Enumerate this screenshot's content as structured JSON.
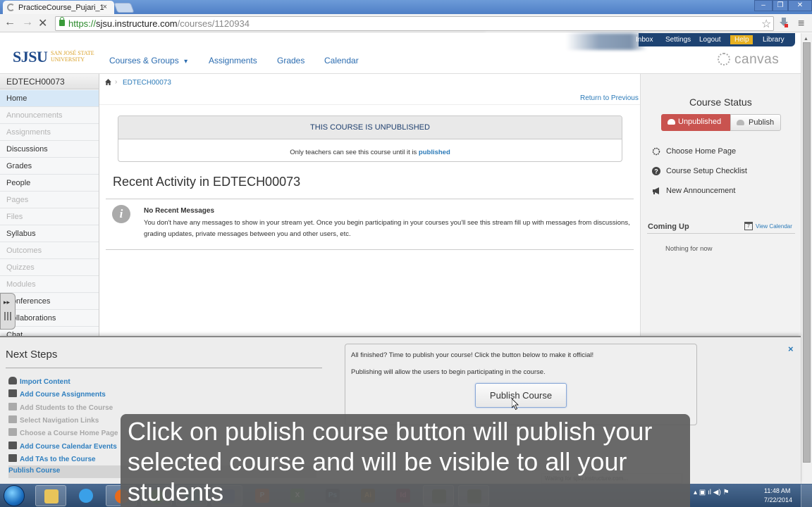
{
  "browser": {
    "tab_title": "PracticeCourse_Pujari_1",
    "tab_close": "×",
    "url_scheme": "https://",
    "url_host": "sjsu.instructure.com",
    "url_path": "/courses/1120934",
    "window_controls": [
      "–",
      "❐",
      "✕"
    ],
    "nav": {
      "back": "←",
      "forward": "→",
      "stop": "✕"
    },
    "star": "☆",
    "menu": "≡",
    "status": "Waiting for sjsu.instructure.com..."
  },
  "header": {
    "logo_main": "SJSU",
    "logo_sub": "SAN JOSÉ STATE UNIVERSITY",
    "nav": [
      "Courses & Groups",
      "Assignments",
      "Grades",
      "Calendar"
    ],
    "dropdown_caret": "▾",
    "user_nav": [
      "Inbox",
      "Settings",
      "Logout",
      "Help",
      "Library"
    ],
    "canvas_brand": "canvas"
  },
  "course": {
    "code": "EDTECH00073",
    "nav": [
      {
        "label": "Home",
        "state": "active"
      },
      {
        "label": "Announcements",
        "state": "off"
      },
      {
        "label": "Assignments",
        "state": "off"
      },
      {
        "label": "Discussions",
        "state": "on"
      },
      {
        "label": "Grades",
        "state": "on"
      },
      {
        "label": "People",
        "state": "on"
      },
      {
        "label": "Pages",
        "state": "off"
      },
      {
        "label": "Files",
        "state": "off"
      },
      {
        "label": "Syllabus",
        "state": "on"
      },
      {
        "label": "Outcomes",
        "state": "off"
      },
      {
        "label": "Quizzes",
        "state": "off"
      },
      {
        "label": "Modules",
        "state": "off"
      },
      {
        "label": "Conferences",
        "state": "on"
      },
      {
        "label": "Collaborations",
        "state": "on"
      },
      {
        "label": "Chat",
        "state": "on"
      }
    ]
  },
  "main": {
    "breadcrumb_sep": "›",
    "breadcrumb": "EDTECH00073",
    "return_previous": "Return to Previous",
    "unpublished_banner": "THIS COURSE IS UNPUBLISHED",
    "unpublished_note": "Only teachers can see this course until it is ",
    "unpublished_link": "published",
    "recent_title": "Recent Activity in EDTECH00073",
    "info_glyph": "i",
    "no_recent_title": "No Recent Messages",
    "no_recent_text": "You don't have any messages to show in your stream yet. Once you begin participating in your courses you'll see this stream fill up with messages from discussions, grading updates, private messages between you and other users, etc."
  },
  "sidebar": {
    "course_status_title": "Course Status",
    "unpublished_label": "Unpublished",
    "publish_label": "Publish",
    "links": [
      "Choose Home Page",
      "Course Setup Checklist",
      "New Announcement"
    ],
    "coming_up_title": "Coming Up",
    "view_calendar": "View Calendar",
    "nothing_now": "Nothing for now",
    "status_color": "#c9534f"
  },
  "next_steps": {
    "title": "Next Steps",
    "steps": [
      {
        "label": "Import Content",
        "state": "on",
        "icon": "cloud-icon"
      },
      {
        "label": "Add Course Assignments",
        "state": "on",
        "icon": "document-icon"
      },
      {
        "label": "Add Students to the Course",
        "state": "off",
        "icon": "users-icon"
      },
      {
        "label": "Select Navigation Links",
        "state": "off",
        "icon": "link-icon"
      },
      {
        "label": "Choose a Course Home Page",
        "state": "off",
        "icon": "home-page-icon"
      },
      {
        "label": "Add Course Calendar Events",
        "state": "on",
        "icon": "calendar-icon"
      },
      {
        "label": "Add TAs to the Course",
        "state": "on",
        "icon": "user-add-icon"
      },
      {
        "label": "Publish Course",
        "state": "on",
        "icon": ""
      }
    ],
    "publish_text1": "All finished? Time to publish your course! Click the button below to make it official!",
    "publish_text2": "Publishing will allow the users to begin participating in the course.",
    "publish_button": "Publish Course",
    "close": "×"
  },
  "caption": "Click on publish course  button will publish your selected course and will be visible to all your students",
  "taskbar": {
    "apps": [
      "explorer",
      "internet-explorer",
      "firefox",
      "chrome",
      "other",
      "word",
      "powerpoint",
      "excel",
      "photoshop",
      "illustrator",
      "indesign",
      "app-1",
      "app-2"
    ],
    "app_glyphs": {
      "powerpoint": "P",
      "excel": "X",
      "photoshop": "Ps",
      "illustrator": "Ai",
      "indesign": "Id"
    },
    "tray": "▴  ▣  ıl  ◀)  ⚑",
    "time": "11:48 AM",
    "date": "7/22/2014"
  }
}
